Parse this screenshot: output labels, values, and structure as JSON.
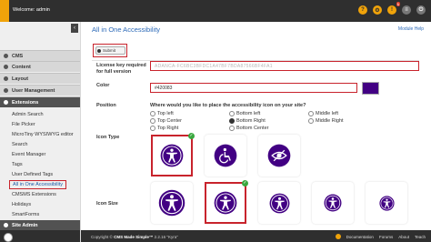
{
  "header": {
    "welcome": "Welcome: admin",
    "notification_count": "1"
  },
  "sidebar": {
    "sections": [
      {
        "label": "CMS"
      },
      {
        "label": "Content"
      },
      {
        "label": "Layout"
      },
      {
        "label": "User Management"
      },
      {
        "label": "Extensions"
      }
    ],
    "items": [
      {
        "label": "Admin Search"
      },
      {
        "label": "File Picker"
      },
      {
        "label": "MicroTiny WYSIWYG editor"
      },
      {
        "label": "Search"
      },
      {
        "label": "Event Manager"
      },
      {
        "label": "Tags"
      },
      {
        "label": "User Defined Tags"
      },
      {
        "label": "All in One Accessibility"
      },
      {
        "label": "CMSMS Extensions"
      },
      {
        "label": "Holidays"
      },
      {
        "label": "SmartForms"
      }
    ],
    "site_admin": "Site Admin"
  },
  "main": {
    "title": "All in One Accessibility",
    "module_help": "Module Help",
    "submit_label": "Submit",
    "license_label": "License key required for full version",
    "license_value": "ADANCA-FC6BC3BFDC1A47BF7BDA87566BF4FA1",
    "color_label": "Color",
    "color_value": "#420083",
    "position_label": "Position",
    "position_question": "Where would you like to place the accessibility icon on your site?",
    "positions": [
      {
        "label": "Top left",
        "selected": false
      },
      {
        "label": "Top Center",
        "selected": false
      },
      {
        "label": "Top Right",
        "selected": false
      },
      {
        "label": "Bottom left",
        "selected": false
      },
      {
        "label": "Bottom Right",
        "selected": true
      },
      {
        "label": "Bottom Center",
        "selected": false
      },
      {
        "label": "Middle left",
        "selected": false
      },
      {
        "label": "Middle Right",
        "selected": false
      }
    ],
    "icon_type_label": "Icon Type",
    "icon_size_label": "Icon Size",
    "icon_types": [
      "person-standing-icon",
      "wheelchair-icon",
      "eye-icon"
    ],
    "selected_icon_type": 0,
    "selected_icon_size": 1
  },
  "footer": {
    "copyright_prefix": "Copyright ©",
    "copyright_brand": "CMS Made Simple™",
    "version": "2.2.16 \"Kyra\"",
    "links": [
      "Documentation",
      "Forums",
      "About",
      "Teach"
    ]
  },
  "colors": {
    "accent": "#420083",
    "highlight": "#c8232c",
    "topbar": "#2f2f2f",
    "orange": "#f0a30a"
  }
}
